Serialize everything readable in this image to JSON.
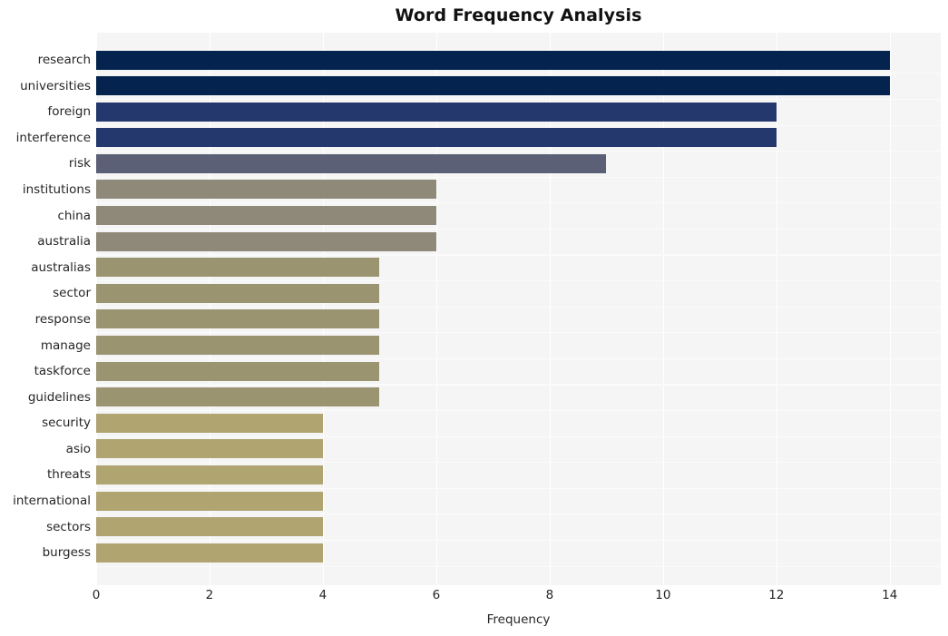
{
  "chart_data": {
    "type": "bar",
    "orientation": "horizontal",
    "title": "Word Frequency Analysis",
    "xlabel": "Frequency",
    "ylabel": "",
    "xlim": [
      0,
      14.9
    ],
    "xticks": [
      0,
      2,
      4,
      6,
      8,
      10,
      12,
      14
    ],
    "xtick_labels": [
      "0",
      "2",
      "4",
      "6",
      "8",
      "10",
      "12",
      "14"
    ],
    "grid": true,
    "legend": null,
    "categories": [
      "research",
      "universities",
      "foreign",
      "interference",
      "risk",
      "institutions",
      "china",
      "australia",
      "australias",
      "sector",
      "response",
      "manage",
      "taskforce",
      "guidelines",
      "security",
      "asio",
      "threats",
      "international",
      "sectors",
      "burgess"
    ],
    "values": [
      14,
      14,
      12,
      12,
      9,
      6,
      6,
      6,
      5,
      5,
      5,
      5,
      5,
      5,
      4,
      4,
      4,
      4,
      4,
      4
    ],
    "bar_colors": [
      "#04244f",
      "#04244f",
      "#24386e",
      "#24386e",
      "#5c6077",
      "#8e8979",
      "#8e8979",
      "#8e8979",
      "#9b9471",
      "#9b9471",
      "#9b9471",
      "#9b9471",
      "#9b9471",
      "#9b9471",
      "#b0a471",
      "#b0a471",
      "#b0a471",
      "#b0a471",
      "#b0a471",
      "#b0a471"
    ],
    "plot_background": "#f5f5f6",
    "grid_color": "#ffffff",
    "figure_background": "#ffffff",
    "text_color": "#262626"
  }
}
